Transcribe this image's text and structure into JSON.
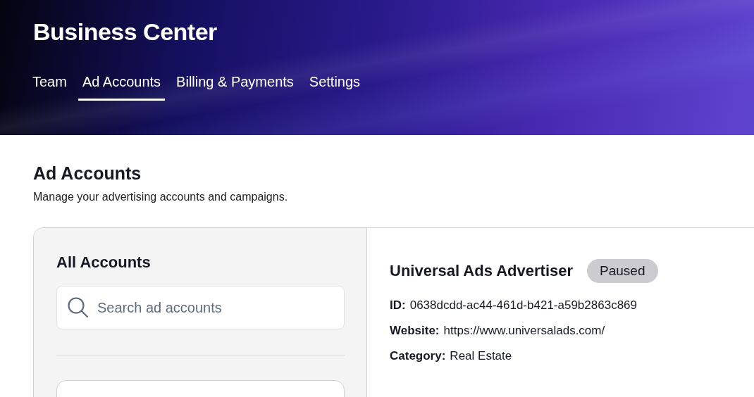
{
  "header": {
    "title": "Business Center"
  },
  "tabs": [
    {
      "label": "Team",
      "selected": false
    },
    {
      "label": "Ad Accounts",
      "selected": true
    },
    {
      "label": "Billing & Payments",
      "selected": false
    },
    {
      "label": "Settings",
      "selected": false
    }
  ],
  "page": {
    "title": "Ad Accounts",
    "subtitle": "Manage your advertising accounts and campaigns."
  },
  "sidebar": {
    "title": "All Accounts",
    "search": {
      "placeholder": "Search ad accounts"
    }
  },
  "account": {
    "name": "Universal Ads Advertiser",
    "status": {
      "label": "Paused",
      "kind": "paused"
    },
    "details": [
      {
        "label": "ID:",
        "value": "0638dcdd-ac44-461d-b421-a59b2863c869"
      },
      {
        "label": "Website:",
        "value": "https://www.universalads.com/"
      },
      {
        "label": "Category:",
        "value": "Real Estate"
      }
    ]
  }
}
